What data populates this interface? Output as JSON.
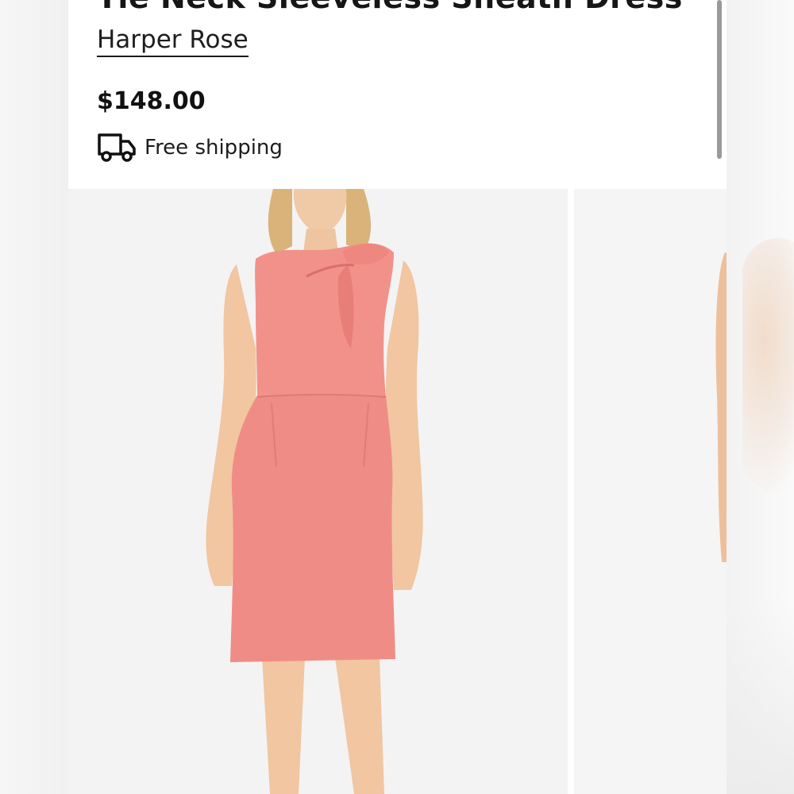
{
  "product": {
    "title": "Tie Neck Sleeveless Sheath Dress",
    "brand": "Harper Rose",
    "price": "$148.00",
    "shipping": "Free shipping"
  },
  "icons": {
    "shipping": "truck-icon"
  },
  "gallery": {
    "images": [
      "model-front-view",
      "model-side-view"
    ]
  },
  "colors": {
    "dress": "#F08C86",
    "background": "#F3F3F4",
    "text": "#1A1A1A"
  }
}
